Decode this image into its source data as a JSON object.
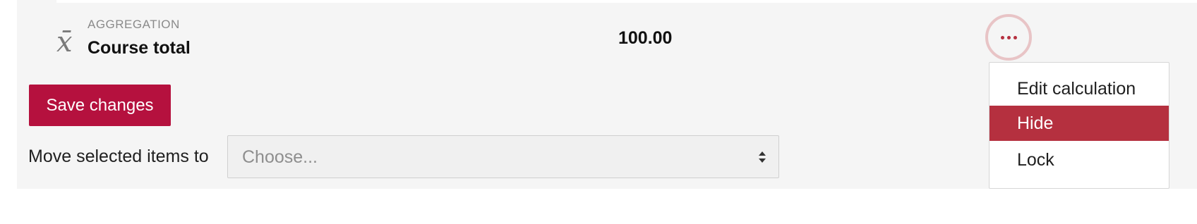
{
  "grade_item": {
    "icon": "aggregation-xbar-icon",
    "icon_glyph": "x̄",
    "type_label": "AGGREGATION",
    "name": "Course total",
    "total": "100.00"
  },
  "actions_menu": {
    "icon": "ellipsis-icon",
    "items": [
      {
        "label": "Edit calculation",
        "active": false
      },
      {
        "label": "Hide",
        "active": true
      },
      {
        "label": "Lock",
        "active": false
      }
    ]
  },
  "form": {
    "save_label": "Save changes",
    "move_label": "Move selected items to",
    "move_select": {
      "placeholder": "Choose...",
      "icon": "updown-caret-icon"
    }
  },
  "colors": {
    "primary": "#b5113e",
    "menu_active": "#b5303f",
    "panel_bg": "#f5f5f5"
  }
}
